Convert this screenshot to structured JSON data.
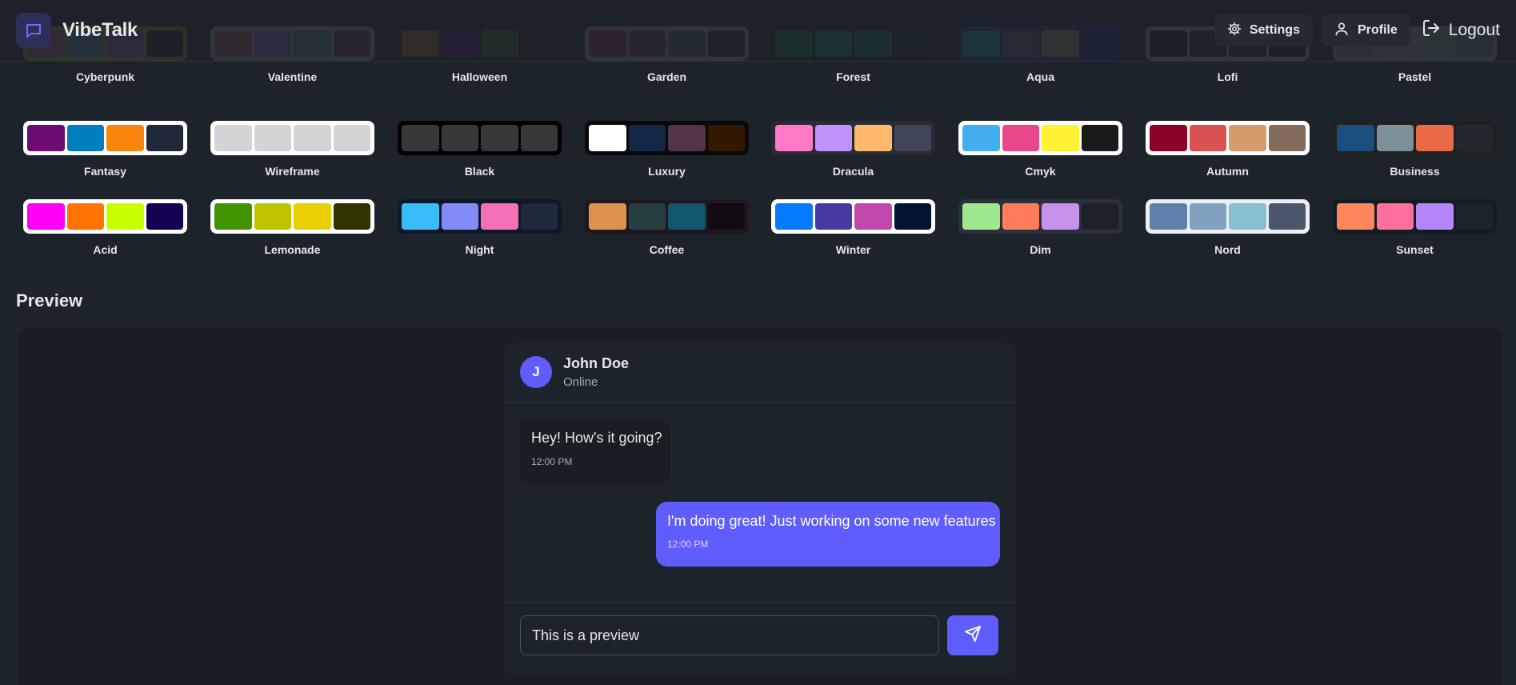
{
  "header": {
    "brand_name": "VibeTalk",
    "settings_label": "Settings",
    "profile_label": "Profile",
    "logout_label": "Logout"
  },
  "themes": [
    {
      "name": "Cyberpunk",
      "frame": "#ffee00",
      "swatches": [
        "#ff7598",
        "#75d1f0",
        "#c07eec",
        "#0d1123"
      ]
    },
    {
      "name": "Valentine",
      "frame": "#ffffff",
      "swatches": [
        "#e96d7b",
        "#a991f7",
        "#66b1b3",
        "#af4670"
      ]
    },
    {
      "name": "Halloween",
      "frame": "#1b1816",
      "swatches": [
        "#ff8f00",
        "#7a00b2",
        "#42a23c",
        "#2a1f10"
      ]
    },
    {
      "name": "Garden",
      "frame": "#ffffff",
      "swatches": [
        "#e20972",
        "#8e4162",
        "#6a8e7e",
        "#2a2314"
      ]
    },
    {
      "name": "Forest",
      "frame": "#171212",
      "swatches": [
        "#1eb854",
        "#1db990",
        "#1ca9a3",
        "#17311f"
      ]
    },
    {
      "name": "Aqua",
      "frame": "#1f3ab0",
      "swatches": [
        "#09ecf3",
        "#966fb3",
        "#ffe999",
        "#0d1f7a"
      ]
    },
    {
      "name": "Lofi",
      "frame": "#ffffff",
      "swatches": [
        "#0d0d0d",
        "#1a1919",
        "#262626",
        "#000000"
      ]
    },
    {
      "name": "Pastel",
      "frame": "#ffffff",
      "swatches": [
        "#d1c1d7",
        "#f6cbd1",
        "#b4e9d6",
        "#70acc7"
      ]
    },
    {
      "name": "Fantasy",
      "frame": "#ffffff",
      "swatches": [
        "#6e0b75",
        "#007ebd",
        "#f8860d",
        "#1f2937"
      ]
    },
    {
      "name": "Wireframe",
      "frame": "#ffffff",
      "swatches": [
        "#d4d4d4",
        "#d4d4d4",
        "#d4d4d4",
        "#d4d4d4"
      ]
    },
    {
      "name": "Black",
      "frame": "#000000",
      "swatches": [
        "#373737",
        "#373737",
        "#373737",
        "#373737"
      ]
    },
    {
      "name": "Luxury",
      "frame": "#09090b",
      "swatches": [
        "#ffffff",
        "#152747",
        "#513448",
        "#331800"
      ]
    },
    {
      "name": "Dracula",
      "frame": "#282a36",
      "swatches": [
        "#ff79c6",
        "#bd93f9",
        "#ffb86c",
        "#414558"
      ]
    },
    {
      "name": "Cmyk",
      "frame": "#ffffff",
      "swatches": [
        "#45aeee",
        "#e8488a",
        "#fff232",
        "#1a1a1a"
      ]
    },
    {
      "name": "Autumn",
      "frame": "#ffffff",
      "swatches": [
        "#8c0327",
        "#d85251",
        "#d59b6a",
        "#826a5c"
      ]
    },
    {
      "name": "Business",
      "frame": "#202020",
      "swatches": [
        "#1c4e80",
        "#7c909a",
        "#ea6947",
        "#23282e"
      ]
    },
    {
      "name": "Acid",
      "frame": "#ffffff",
      "swatches": [
        "#ff00f4",
        "#ff7400",
        "#c8ff00",
        "#140152"
      ]
    },
    {
      "name": "Lemonade",
      "frame": "#ffffff",
      "swatches": [
        "#419400",
        "#bfc300",
        "#eacf00",
        "#313300"
      ]
    },
    {
      "name": "Night",
      "frame": "#0f172a",
      "swatches": [
        "#38bdf8",
        "#818cf8",
        "#f471b5",
        "#1e293b"
      ]
    },
    {
      "name": "Coffee",
      "frame": "#20161f",
      "swatches": [
        "#db924b",
        "#263e3f",
        "#10576d",
        "#120c12"
      ]
    },
    {
      "name": "Winter",
      "frame": "#ffffff",
      "swatches": [
        "#047aff",
        "#463aa2",
        "#c148ac",
        "#021431"
      ]
    },
    {
      "name": "Dim",
      "frame": "#2a303c",
      "swatches": [
        "#9fe88d",
        "#ff7d5c",
        "#c792e9",
        "#1c212b"
      ]
    },
    {
      "name": "Nord",
      "frame": "#eceff4",
      "swatches": [
        "#5e81ac",
        "#81a1c1",
        "#88c0d0",
        "#4c566a"
      ]
    },
    {
      "name": "Sunset",
      "frame": "#121c22",
      "swatches": [
        "#ff865b",
        "#fd6f9c",
        "#b387fa",
        "#1b262c"
      ]
    }
  ],
  "preview": {
    "title": "Preview",
    "contact_initial": "J",
    "contact_name": "John Doe",
    "contact_status": "Online",
    "messages": [
      {
        "text": "Hey! How's it going?",
        "time": "12:00 PM"
      },
      {
        "text": "I'm doing great! Just working on some new features",
        "time": "12:00 PM"
      }
    ],
    "input_value": "This is a preview"
  },
  "colors": {
    "accent": "#605dff",
    "background": "#1d232a"
  }
}
